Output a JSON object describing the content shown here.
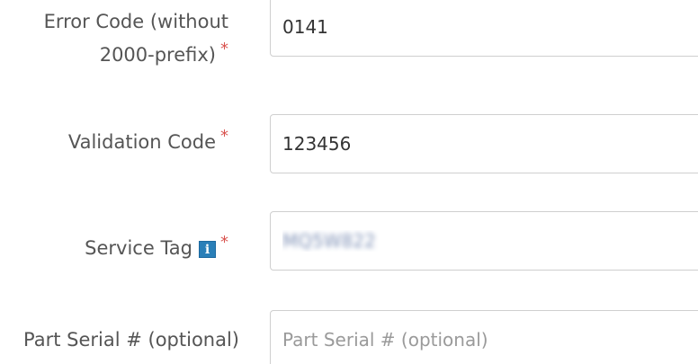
{
  "form": {
    "error_code": {
      "label_line1": "Error Code (without",
      "label_line2": "2000-prefix)",
      "required_mark": "*",
      "value": "0141"
    },
    "validation_code": {
      "label": "Validation Code",
      "required_mark": "*",
      "value": "123456"
    },
    "service_tag": {
      "label": "Service Tag",
      "info_icon_glyph": "i",
      "required_mark": "*",
      "value": "MQ5W822"
    },
    "part_serial": {
      "label": "Part Serial # (optional)",
      "placeholder": "Part Serial # (optional)",
      "value": ""
    }
  },
  "colors": {
    "label_text": "#555555",
    "required": "#d9534f",
    "info_icon": "#2a7fb8",
    "input_border": "#cfcfcf"
  }
}
